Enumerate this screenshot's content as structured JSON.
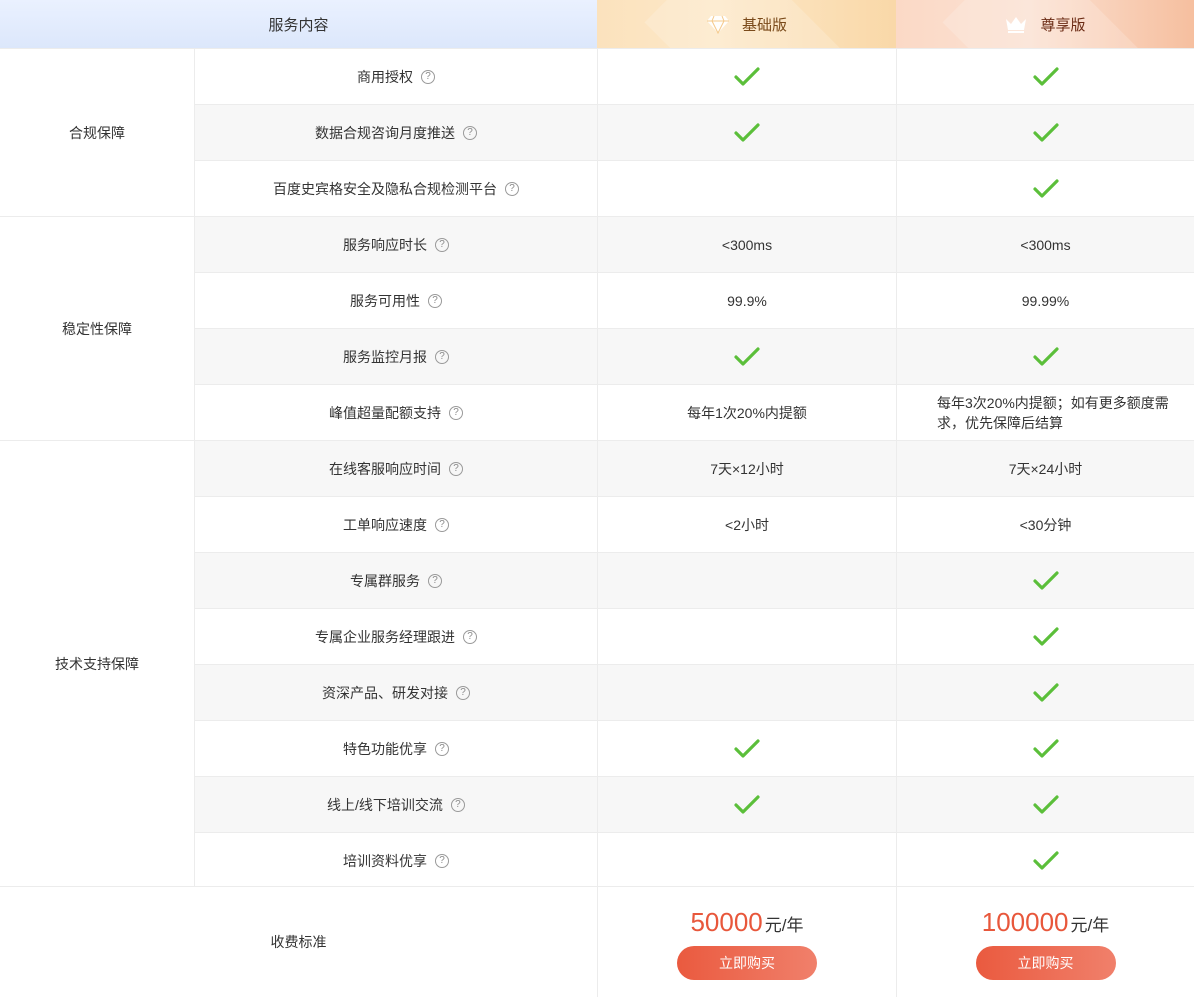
{
  "header": {
    "content_label": "服务内容",
    "basic_label": "基础版",
    "premium_label": "尊享版"
  },
  "categories": [
    {
      "label": "合规保障"
    },
    {
      "label": "稳定性保障"
    },
    {
      "label": "技术支持保障"
    }
  ],
  "rows": [
    {
      "feature": "商用授权",
      "basic": "check",
      "premium": "check"
    },
    {
      "feature": "数据合规咨询月度推送",
      "basic": "check",
      "premium": "check"
    },
    {
      "feature": "百度史宾格安全及隐私合规检测平台",
      "basic": "",
      "premium": "check"
    },
    {
      "feature": "服务响应时长",
      "basic": "<300ms",
      "premium": "<300ms"
    },
    {
      "feature": "服务可用性",
      "basic": "99.9%",
      "premium": "99.99%"
    },
    {
      "feature": "服务监控月报",
      "basic": "check",
      "premium": "check"
    },
    {
      "feature": "峰值超量配额支持",
      "basic": "每年1次20%内提额",
      "premium": "每年3次20%内提额；如有更多额度需求，优先保障后结算"
    },
    {
      "feature": "在线客服响应时间",
      "basic": "7天×12小时",
      "premium": "7天×24小时"
    },
    {
      "feature": "工单响应速度",
      "basic": "<2小时",
      "premium": "<30分钟"
    },
    {
      "feature": "专属群服务",
      "basic": "",
      "premium": "check"
    },
    {
      "feature": "专属企业服务经理跟进",
      "basic": "",
      "premium": "check"
    },
    {
      "feature": "资深产品、研发对接",
      "basic": "",
      "premium": "check"
    },
    {
      "feature": "特色功能优享",
      "basic": "check",
      "premium": "check"
    },
    {
      "feature": "线上/线下培训交流",
      "basic": "check",
      "premium": "check"
    },
    {
      "feature": "培训资料优享",
      "basic": "",
      "premium": "check"
    }
  ],
  "fee": {
    "label": "收费标准",
    "basic_price": "50000",
    "premium_price": "100000",
    "unit": "元/年",
    "buy_label": "立即购买"
  },
  "icons": {
    "help": "question-circle-icon",
    "check": "check-icon",
    "basic": "diamond-icon",
    "premium": "crown-icon"
  },
  "colors": {
    "accent": "#e8573b",
    "check": "#5bbf3a"
  }
}
